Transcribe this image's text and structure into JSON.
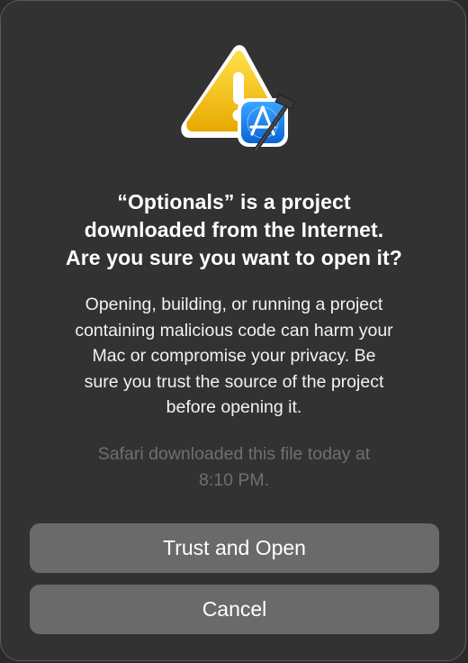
{
  "dialog": {
    "title": "“Optionals” is a project\ndownloaded from the Internet.\nAre you sure you want to open it?",
    "message": "Opening, building, or running a project\ncontaining malicious code can harm your\nMac or compromise your privacy. Be\nsure you trust the source of the project\nbefore opening it.",
    "note": "Safari downloaded this file today at\n8:10 PM.",
    "icon": "warning-triangle-with-xcode-icon",
    "buttons": {
      "trust_label": "Trust and Open",
      "cancel_label": "Cancel"
    },
    "colors": {
      "background": "#323232",
      "button": "#6a6a6a",
      "warning_yellow": "#f5c518",
      "xcode_blue": "#1e8cf0",
      "muted_text": "#6f6f6f"
    }
  }
}
